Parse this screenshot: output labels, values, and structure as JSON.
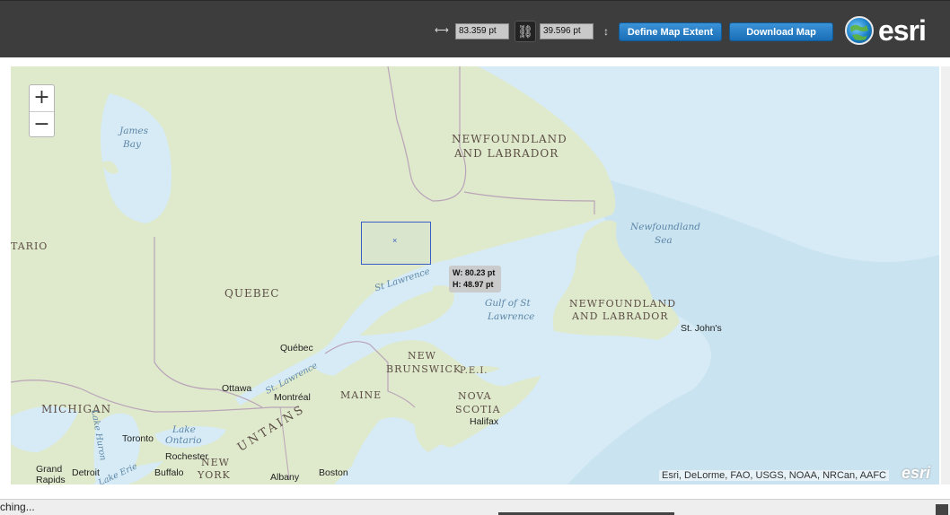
{
  "toolbar": {
    "width_value": "83.359 pt",
    "height_value": "39.596 pt",
    "width_icon": "width-arrows-icon",
    "link_icon": "chain-link-icon",
    "height_icon": "height-arrows-icon",
    "define_extent_label": "Define Map Extent",
    "download_label": "Download Map",
    "logo_text": "esri"
  },
  "map": {
    "zoom_in": "+",
    "zoom_out": "−",
    "labels": {
      "nl_mainland_1": "NEWFOUNDLAND",
      "nl_mainland_2": "AND LABRADOR",
      "nl_island_1": "NEWFOUNDLAND",
      "nl_island_2": "AND LABRADOR",
      "ontario": "TARIO",
      "quebec": "QUEBEC",
      "new_brunswick_1": "NEW",
      "new_brunswick_2": "BRUNSWICK",
      "pei": "P.E.I.",
      "nova_scotia_1": "NOVA",
      "nova_scotia_2": "SCOTIA",
      "maine": "MAINE",
      "michigan": "MICHIGAN",
      "new_york_1": "NEW",
      "new_york_2": "YORK",
      "mountains": "UNTAINS",
      "james_bay_1": "James",
      "james_bay_2": "Bay",
      "newfoundland_sea_1": "Newfoundland",
      "newfoundland_sea_2": "Sea",
      "st_lawrence": "St Lawrence",
      "st_lawrence_river": "St. Lawrence",
      "gulf_1": "Gulf of St",
      "gulf_2": "Lawrence",
      "lake_ontario_1": "Lake",
      "lake_ontario_2": "Ontario",
      "lake_huron": "Lake Huron",
      "lake_erie": "Lake Erie",
      "st_johns": "St. John's",
      "quebec_city": "Québec",
      "ottawa": "Ottawa",
      "montreal": "Montréal",
      "halifax": "Halifax",
      "toronto": "Toronto",
      "rochester": "Rochester",
      "buffalo": "Buffalo",
      "detroit": "Detroit",
      "grand_rapids_1": "Grand",
      "grand_rapids_2": "Rapids",
      "albany": "Albany",
      "boston": "Boston"
    },
    "selection_width": "W: 80.23 pt",
    "selection_height": "H: 48.97 pt",
    "attribution": "Esri, DeLorme, FAO, USGS, NOAA, NRCan, AAFC",
    "esri_watermark": "esri",
    "colors": {
      "land": "#dfe9cc",
      "water": "#d6ebf5",
      "deep_water": "#c3e0ee",
      "border": "#b9a4b8",
      "extent": "#3a5cc5"
    }
  },
  "status_text": "ching..."
}
